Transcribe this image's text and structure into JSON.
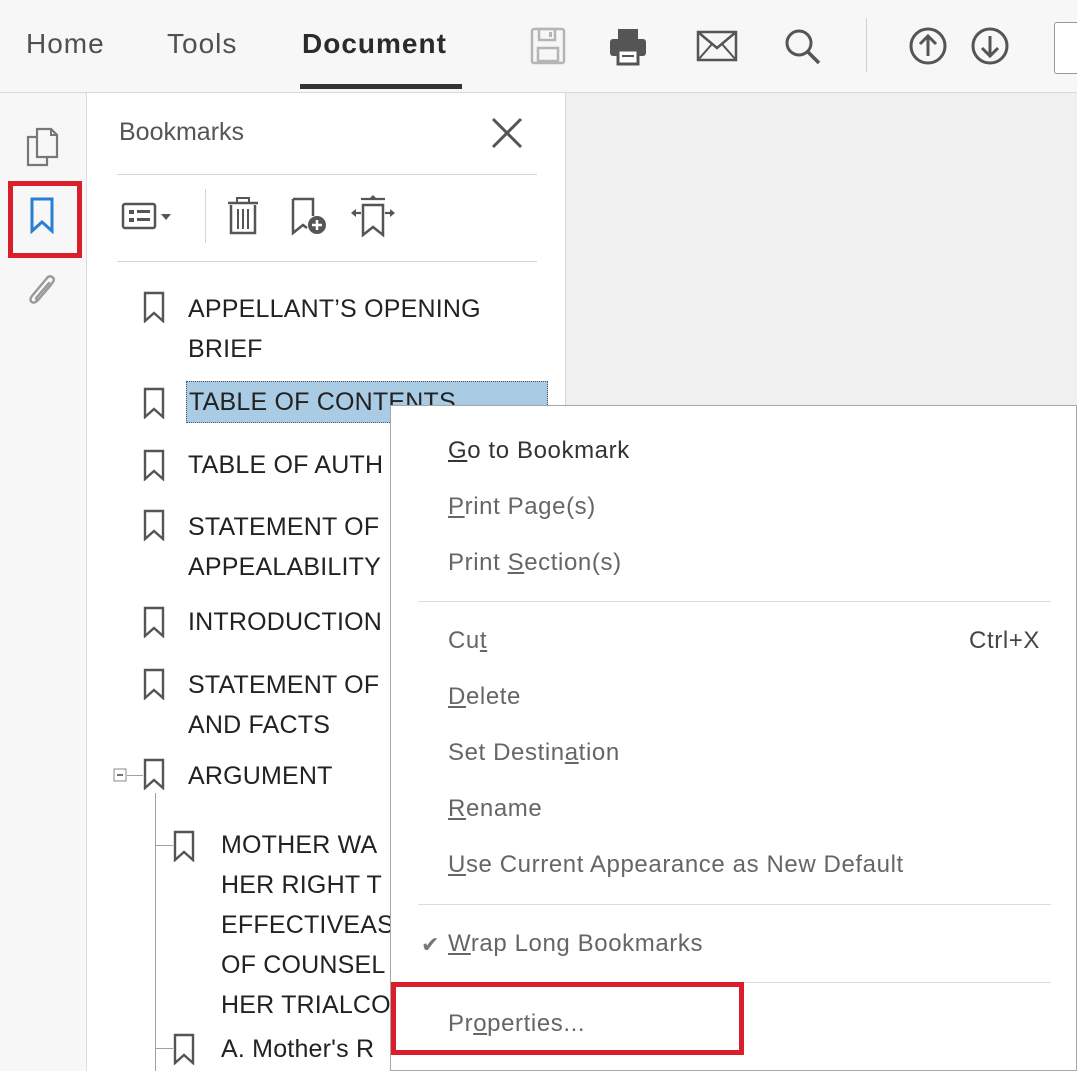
{
  "toolbar": {
    "tabs": [
      {
        "label": "Home"
      },
      {
        "label": "Tools"
      },
      {
        "label": "Document"
      }
    ],
    "icons": [
      "save-icon",
      "print-icon",
      "email-icon",
      "search-icon",
      "prev-page-icon",
      "next-page-icon"
    ]
  },
  "rail": {
    "icons": [
      "page-thumbnails-icon",
      "bookmark-icon",
      "attachment-icon"
    ],
    "highlight_color": "#d81f2a"
  },
  "bookmarks_panel": {
    "title": "Bookmarks",
    "tools": [
      "options-menu-icon",
      "delete-icon",
      "new-bookmark-icon",
      "expand-bookmark-icon"
    ],
    "items": [
      {
        "line1": "APPELLANT’S OPENING",
        "line2": "BRIEF"
      },
      {
        "line1": "TABLE OF CONTENTS",
        "selected": true
      },
      {
        "line1": "TABLE OF AUTH"
      },
      {
        "line1": "STATEMENT OF",
        "line2": "APPEALABILITY"
      },
      {
        "line1": "INTRODUCTION"
      },
      {
        "line1": "STATEMENT OF",
        "line2": "AND FACTS"
      },
      {
        "line1": "ARGUMENT",
        "expanded": true
      },
      {
        "line1": "MOTHER WA",
        "line2": "HER RIGHT T",
        "line3": "EFFECTIVEAS",
        "line4": "OF COUNSEL",
        "line5": "HER TRIALCO"
      },
      {
        "line1": "A. Mother's R"
      }
    ],
    "selected_color": "#a9cbe3"
  },
  "context_menu": {
    "items": {
      "go_to_bookmark": {
        "pre": "",
        "accel": "G",
        "post": "o to Bookmark"
      },
      "print_pages": {
        "pre": "",
        "accel": "P",
        "post": "rint Page(s)"
      },
      "print_section": {
        "pre": "Print ",
        "accel": "S",
        "post": "ection(s)"
      },
      "cut": {
        "pre": "Cu",
        "accel": "t",
        "post": "",
        "shortcut": "Ctrl+X"
      },
      "delete": {
        "pre": "",
        "accel": "D",
        "post": "elete"
      },
      "set_destination": {
        "pre": "Set Destin",
        "accel": "a",
        "post": "tion"
      },
      "rename": {
        "pre": "",
        "accel": "R",
        "post": "ename"
      },
      "use_current_appearance": {
        "pre": "",
        "accel": "U",
        "post": "se Current Appearance as New Default"
      },
      "wrap_long_bookmarks": {
        "pre": "",
        "accel": "W",
        "post": "rap Long Bookmarks",
        "checked": true,
        "check_glyph": "✔"
      },
      "properties": {
        "pre": "Pr",
        "accel": "o",
        "post": "perties..."
      }
    }
  }
}
